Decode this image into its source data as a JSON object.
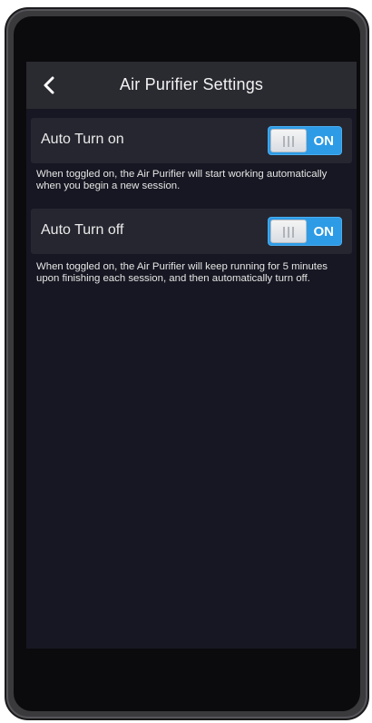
{
  "header": {
    "title": "Air Purifier Settings",
    "back_icon": "chevron-left-icon"
  },
  "settings": [
    {
      "label": "Auto Turn on",
      "toggle_state": "ON",
      "description": "When toggled on, the Air Purifier will start working automatically when you begin a new session."
    },
    {
      "label": "Auto Turn off",
      "toggle_state": "ON",
      "description": "When toggled on, the Air Purifier will keep running for 5 minutes upon finishing each session, and then automatically turn off."
    }
  ],
  "colors": {
    "toggle_on": "#2d9be6",
    "screen_bg": "#161722",
    "titlebar_bg": "#2a2a31",
    "row_bg": "#262630"
  }
}
